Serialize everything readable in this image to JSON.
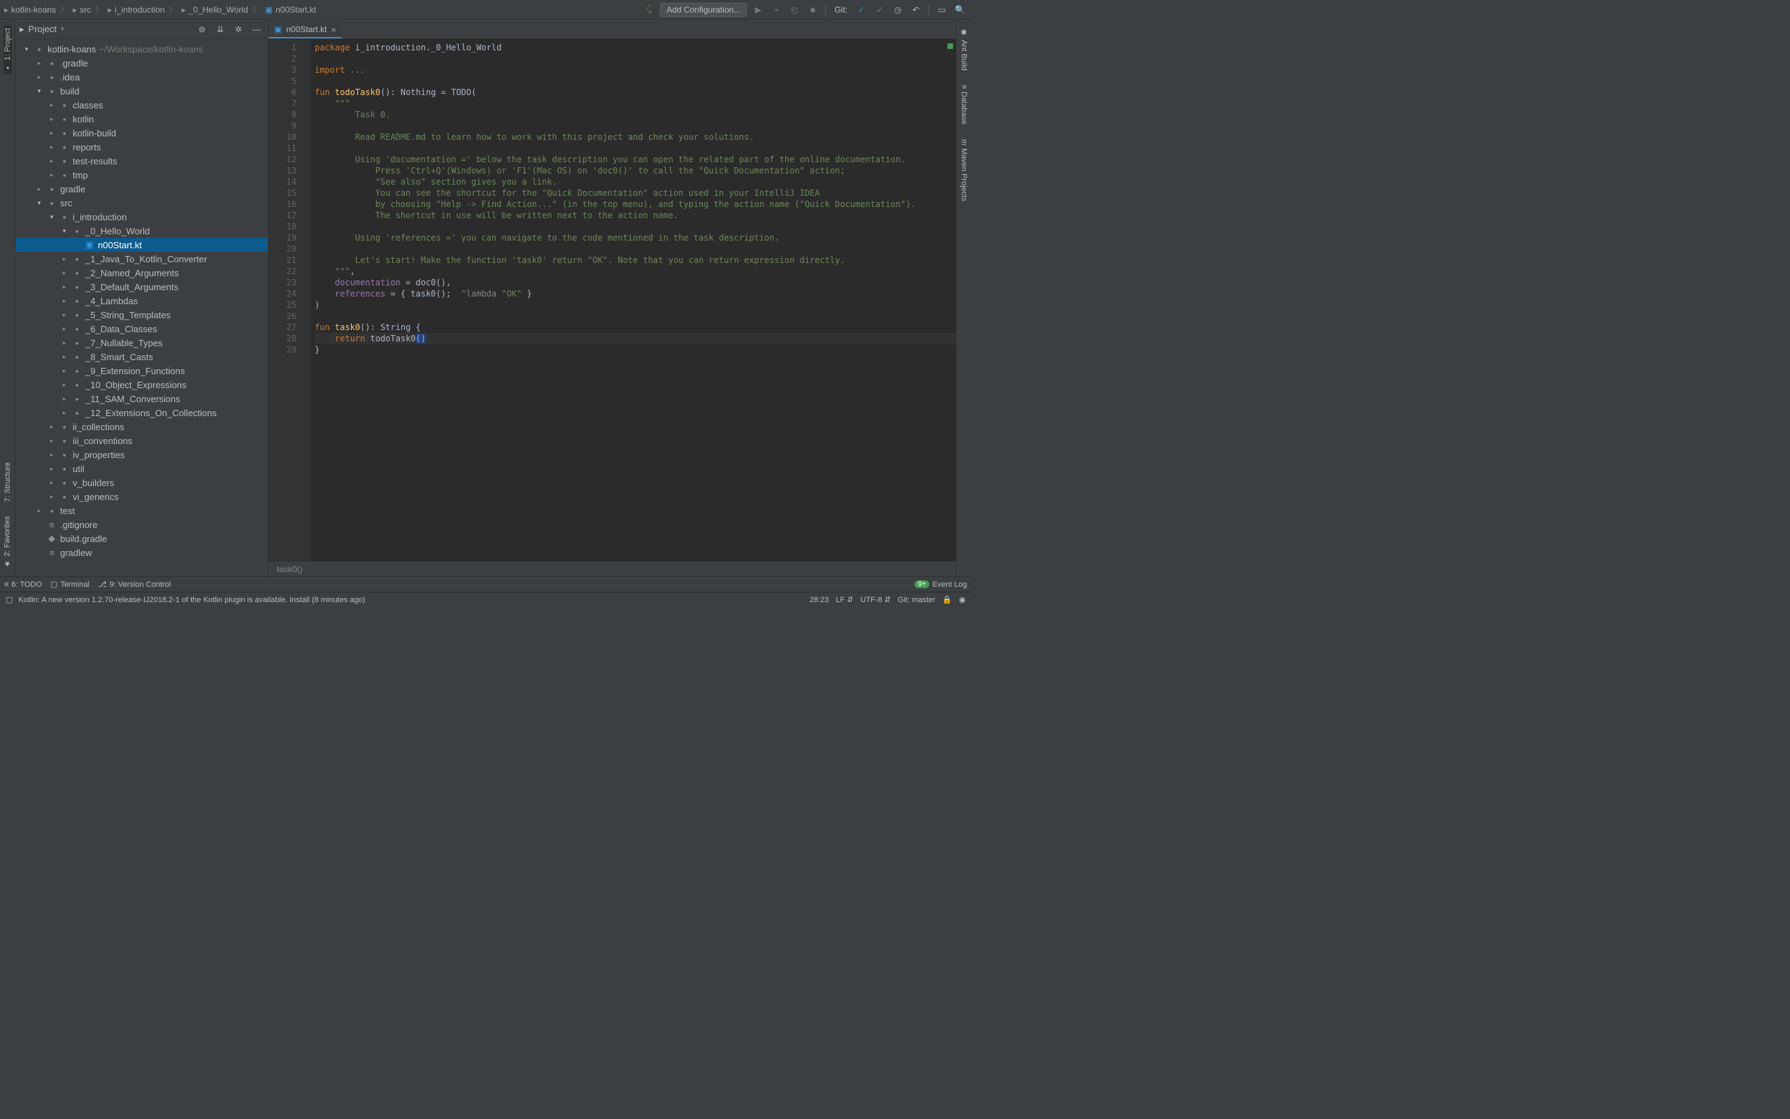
{
  "breadcrumbs": [
    "kotlin-koans",
    "src",
    "i_introduction",
    "_0_Hello_World",
    "n00Start.kt"
  ],
  "toolbar": {
    "add_config": "Add Configuration...",
    "git_label": "Git:"
  },
  "left_gutter": {
    "project": "1: Project",
    "structure": "7: Structure",
    "favorites": "2: Favorites"
  },
  "right_gutter": {
    "ant": "Ant Build",
    "database": "Database",
    "maven": "Maven Projects"
  },
  "project_panel": {
    "title": "Project"
  },
  "tree": [
    {
      "d": 0,
      "open": true,
      "icon": "project",
      "label": "kotlin-koans",
      "path": "~/Workspace/kotlin-koans"
    },
    {
      "d": 1,
      "open": false,
      "icon": "folder",
      "label": ".gradle"
    },
    {
      "d": 1,
      "open": false,
      "icon": "folder",
      "label": ".idea"
    },
    {
      "d": 1,
      "open": true,
      "icon": "folder",
      "label": "build"
    },
    {
      "d": 2,
      "open": false,
      "icon": "folder",
      "label": "classes"
    },
    {
      "d": 2,
      "open": false,
      "icon": "folder",
      "label": "kotlin"
    },
    {
      "d": 2,
      "open": false,
      "icon": "folder",
      "label": "kotlin-build"
    },
    {
      "d": 2,
      "open": false,
      "icon": "folder",
      "label": "reports"
    },
    {
      "d": 2,
      "open": false,
      "icon": "folder",
      "label": "test-results"
    },
    {
      "d": 2,
      "open": false,
      "icon": "folder",
      "label": "tmp"
    },
    {
      "d": 1,
      "open": false,
      "icon": "folder",
      "label": "gradle"
    },
    {
      "d": 1,
      "open": true,
      "icon": "folder",
      "label": "src"
    },
    {
      "d": 2,
      "open": true,
      "icon": "folder",
      "label": "i_introduction"
    },
    {
      "d": 3,
      "open": true,
      "icon": "folder",
      "label": "_0_Hello_World"
    },
    {
      "d": 4,
      "leaf": true,
      "icon": "kt",
      "label": "n00Start.kt",
      "selected": true
    },
    {
      "d": 3,
      "open": false,
      "icon": "folder",
      "label": "_1_Java_To_Kotlin_Converter"
    },
    {
      "d": 3,
      "open": false,
      "icon": "folder",
      "label": "_2_Named_Arguments"
    },
    {
      "d": 3,
      "open": false,
      "icon": "folder",
      "label": "_3_Default_Arguments"
    },
    {
      "d": 3,
      "open": false,
      "icon": "folder",
      "label": "_4_Lambdas"
    },
    {
      "d": 3,
      "open": false,
      "icon": "folder",
      "label": "_5_String_Templates"
    },
    {
      "d": 3,
      "open": false,
      "icon": "folder",
      "label": "_6_Data_Classes"
    },
    {
      "d": 3,
      "open": false,
      "icon": "folder",
      "label": "_7_Nullable_Types"
    },
    {
      "d": 3,
      "open": false,
      "icon": "folder",
      "label": "_8_Smart_Casts"
    },
    {
      "d": 3,
      "open": false,
      "icon": "folder",
      "label": "_9_Extension_Functions"
    },
    {
      "d": 3,
      "open": false,
      "icon": "folder",
      "label": "_10_Object_Expressions"
    },
    {
      "d": 3,
      "open": false,
      "icon": "folder",
      "label": "_11_SAM_Conversions"
    },
    {
      "d": 3,
      "open": false,
      "icon": "folder",
      "label": "_12_Extensions_On_Collections"
    },
    {
      "d": 2,
      "open": false,
      "icon": "folder",
      "label": "ii_collections"
    },
    {
      "d": 2,
      "open": false,
      "icon": "folder",
      "label": "iii_conventions"
    },
    {
      "d": 2,
      "open": false,
      "icon": "folder",
      "label": "iv_properties"
    },
    {
      "d": 2,
      "open": false,
      "icon": "folder",
      "label": "util"
    },
    {
      "d": 2,
      "open": false,
      "icon": "folder",
      "label": "v_builders"
    },
    {
      "d": 2,
      "open": false,
      "icon": "folder",
      "label": "vi_generics"
    },
    {
      "d": 1,
      "open": false,
      "icon": "folder",
      "label": "test"
    },
    {
      "d": 1,
      "leaf": true,
      "icon": "file",
      "label": ".gitignore"
    },
    {
      "d": 1,
      "leaf": true,
      "icon": "gradle",
      "label": "build.gradle"
    },
    {
      "d": 1,
      "leaf": true,
      "icon": "file",
      "label": "gradlew"
    }
  ],
  "tab": {
    "label": "n00Start.kt"
  },
  "code_lines": [
    {
      "n": 1,
      "html": "<span class='kw'>package</span> i_introduction._0_Hello_World"
    },
    {
      "n": 2,
      "html": ""
    },
    {
      "n": 3,
      "html": "<span class='kw'>import</span> <span class='comment'>...</span>"
    },
    {
      "n": 5,
      "html": ""
    },
    {
      "n": 6,
      "html": "<span class='kw'>fun</span> <span class='fn'>todoTask0</span>(): Nothing = TODO("
    },
    {
      "n": 7,
      "html": "    <span class='str'>\"\"\"</span>"
    },
    {
      "n": 8,
      "html": "<span class='str'>        Task 0.</span>"
    },
    {
      "n": 9,
      "html": ""
    },
    {
      "n": 10,
      "html": "<span class='str'>        Read README.md to learn how to work with this project and check your solutions.</span>"
    },
    {
      "n": 11,
      "html": ""
    },
    {
      "n": 12,
      "html": "<span class='str'>        Using 'documentation =' below the task description you can open the related part of the online documentation.</span>"
    },
    {
      "n": 13,
      "html": "<span class='str'>            Press 'Ctrl+Q'(Windows) or 'F1'(Mac OS) on 'doc0()' to call the \"Quick Documentation\" action;</span>"
    },
    {
      "n": 14,
      "html": "<span class='str'>            \"See also\" section gives you a link.</span>"
    },
    {
      "n": 15,
      "html": "<span class='str'>            You can see the shortcut for the \"Quick Documentation\" action used in your IntelliJ IDEA</span>"
    },
    {
      "n": 16,
      "html": "<span class='str'>            by choosing \"Help -> Find Action...\" (in the top menu), and typing the action name (\"Quick Documentation\").</span>"
    },
    {
      "n": 17,
      "html": "<span class='str'>            The shortcut in use will be written next to the action name.</span>"
    },
    {
      "n": 18,
      "html": ""
    },
    {
      "n": 19,
      "html": "<span class='str'>        Using 'references =' you can navigate to the code mentioned in the task description.</span>"
    },
    {
      "n": 20,
      "html": ""
    },
    {
      "n": 21,
      "html": "<span class='str'>        Let's start! Make the function 'task0' return \"OK\". Note that you can return expression directly.</span>"
    },
    {
      "n": 22,
      "html": "    <span class='str'>\"\"\"</span>,"
    },
    {
      "n": 23,
      "html": "    <span class='ident'>documentation</span> = doc0(),"
    },
    {
      "n": 24,
      "html": "    <span class='ident'>references</span> = { task0(); <span class='comment'> ^lambda </span><span class='str'>\"OK\"</span> }"
    },
    {
      "n": 25,
      "html": ")"
    },
    {
      "n": 26,
      "html": ""
    },
    {
      "n": 27,
      "html": "<span class='kw'>fun</span> <span class='fn'>task0</span>(): String {"
    },
    {
      "n": 28,
      "html": "    <span class='kw'>return</span> todoTask0<span style='background:#214283'>()</span>",
      "hl": true
    },
    {
      "n": 29,
      "html": "}"
    }
  ],
  "editor_status": "task0()",
  "bottom": {
    "todo": "6: TODO",
    "terminal": "Terminal",
    "vcs": "9: Version Control",
    "event_log": "Event Log"
  },
  "status": {
    "message": "Kotlin: A new version 1.2.70-release-IJ2018.2-1 of the Kotlin plugin is available. Install (8 minutes ago)",
    "pos": "28:23",
    "lf": "LF",
    "enc": "UTF-8",
    "git": "Git: master"
  }
}
